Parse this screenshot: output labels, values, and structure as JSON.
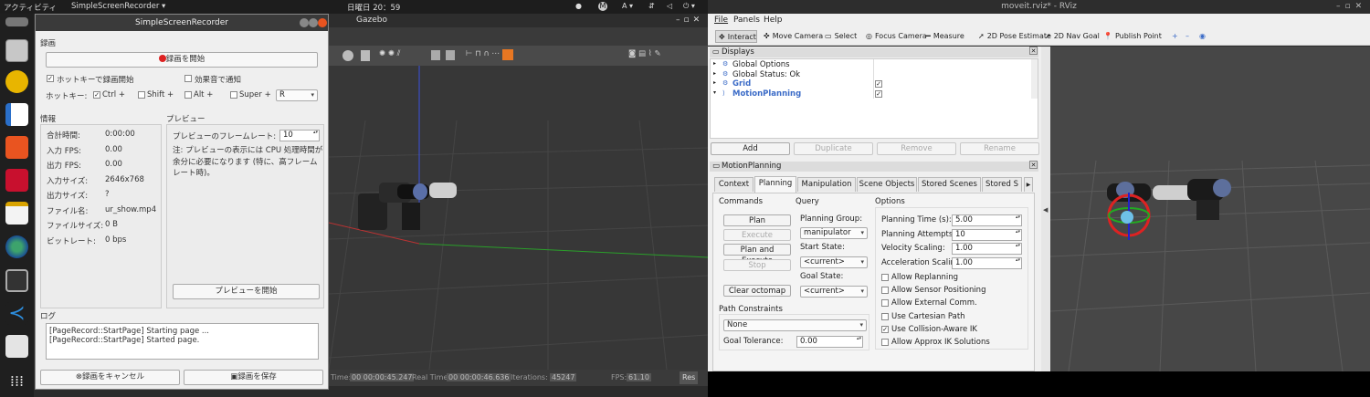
{
  "topbar": {
    "activities": "アクティビティ",
    "app_menu": "SimpleScreenRecorder",
    "clock": "日曜日 20：59",
    "lang": "A",
    "avatar": "M"
  },
  "dock": {
    "icons": [
      "files-icon",
      "rhythmbox-icon",
      "writer-icon",
      "software-icon",
      "calendar-icon",
      "editor-icon",
      "globe-icon",
      "clapper-icon",
      "vscode-icon",
      "search-icon",
      "apps-grid-icon"
    ]
  },
  "gazebo": {
    "title": "Gazebo",
    "status": {
      "sim_time_label": "Time:",
      "sim_time": "00 00:00:45.247",
      "real_time_label": "Real Time:",
      "real_time": "00 00:00:46.636",
      "iterations_label": "Iterations:",
      "iterations": "45247",
      "fps_label": "FPS:",
      "fps": "61.10",
      "reset": "Res"
    }
  },
  "ssr": {
    "title": "SimpleScreenRecorder",
    "recording_section": "録画",
    "start_recording": "録画を開始",
    "hotkey_enable": "ホットキーで録画開始",
    "sound_notify": "効果音で通知",
    "hotkey_label": "ホットキー:",
    "mods": {
      "ctrl": "Ctrl +",
      "shift": "Shift +",
      "alt": "Alt +",
      "super": "Super +"
    },
    "key_value": "R",
    "info_section": "情報",
    "info": [
      {
        "label": "合計時間:",
        "value": "0:00:00"
      },
      {
        "label": "入力 FPS:",
        "value": "0.00"
      },
      {
        "label": "出力 FPS:",
        "value": "0.00"
      },
      {
        "label": "入力サイズ:",
        "value": "2646x768"
      },
      {
        "label": "出力サイズ:",
        "value": "?"
      },
      {
        "label": "ファイル名:",
        "value": "ur_show.mp4"
      },
      {
        "label": "ファイルサイズ:",
        "value": "0 B"
      },
      {
        "label": "ビットレート:",
        "value": "0 bps"
      }
    ],
    "preview_section": "プレビュー",
    "preview_fps_label": "プレビューのフレームレート:",
    "preview_fps": "10",
    "preview_note": "注: プレビューの表示には CPU 処理時間が余分に必要になります (特に、高フレームレート時)。",
    "start_preview": "プレビューを開始",
    "log_section": "ログ",
    "log": [
      "[PageRecord::StartPage] Starting page ...",
      "[PageRecord::StartPage] Started page."
    ],
    "cancel": "録画をキャンセル",
    "save": "録画を保存"
  },
  "rviz": {
    "title": "moveit.rviz* - RViz",
    "menu": [
      "File",
      "Panels",
      "Help"
    ],
    "tools": [
      {
        "label": "Interact",
        "icon": "interact-icon",
        "glyph": "✥"
      },
      {
        "label": "Move Camera",
        "icon": "move-camera-icon",
        "glyph": "✜"
      },
      {
        "label": "Select",
        "icon": "select-icon",
        "glyph": "▭"
      },
      {
        "label": "Focus Camera",
        "icon": "focus-camera-icon",
        "glyph": "◎"
      },
      {
        "label": "Measure",
        "icon": "measure-icon",
        "glyph": "━"
      },
      {
        "label": "2D Pose Estimate",
        "icon": "pose-estimate-icon",
        "glyph": "➚"
      },
      {
        "label": "2D Nav Goal",
        "icon": "nav-goal-icon",
        "glyph": "➚"
      },
      {
        "label": "Publish Point",
        "icon": "publish-point-icon",
        "glyph": "📍"
      }
    ],
    "displays_title": "Displays",
    "displays": [
      {
        "name": "Global Options",
        "value": ""
      },
      {
        "name": "Global Status: Ok",
        "value": ""
      },
      {
        "name": "Grid",
        "value": "✓"
      },
      {
        "name": "MotionPlanning",
        "value": "✓"
      }
    ],
    "display_buttons": [
      "Add",
      "Duplicate",
      "Remove",
      "Rename"
    ],
    "mp_title": "MotionPlanning",
    "tabs": [
      "Context",
      "Planning",
      "Manipulation",
      "Scene Objects",
      "Stored Scenes",
      "Stored S"
    ],
    "commands_label": "Commands",
    "commands": [
      "Plan",
      "Execute",
      "Plan and Execute",
      "Stop",
      "Clear octomap"
    ],
    "query_label": "Query",
    "planning_group_label": "Planning Group:",
    "planning_group": "manipulator",
    "start_state_label": "Start State:",
    "start_state": "<current>",
    "goal_state_label": "Goal State:",
    "goal_state": "<current>",
    "options_label": "Options",
    "options": [
      {
        "label": "Planning Time (s):",
        "value": "5.00"
      },
      {
        "label": "Planning Attempts:",
        "value": "10"
      },
      {
        "label": "Velocity Scaling:",
        "value": "1.00"
      },
      {
        "label": "Acceleration Scaling:",
        "value": "1.00"
      }
    ],
    "checks": [
      {
        "label": "Allow Replanning",
        "on": ""
      },
      {
        "label": "Allow Sensor Positioning",
        "on": ""
      },
      {
        "label": "Allow External Comm.",
        "on": ""
      },
      {
        "label": "Use Cartesian Path",
        "on": ""
      },
      {
        "label": "Use Collision-Aware IK",
        "on": "✓"
      },
      {
        "label": "Allow Approx IK Solutions",
        "on": ""
      }
    ],
    "path_constraints_label": "Path Constraints",
    "path_constraints": "None",
    "goal_tolerance_label": "Goal Tolerance:",
    "goal_tolerance": "0.00"
  }
}
